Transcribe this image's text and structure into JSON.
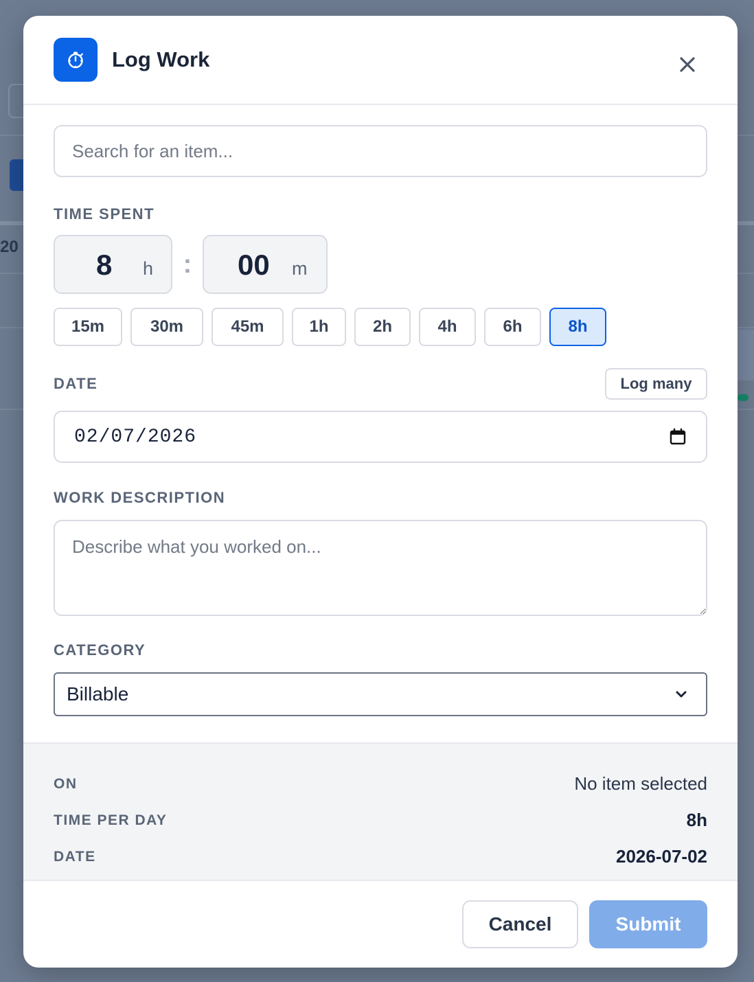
{
  "modal": {
    "title": "Log Work",
    "header_icon": "stopwatch-icon",
    "close_icon": "close-icon"
  },
  "search": {
    "placeholder": "Search for an item...",
    "value": ""
  },
  "time_spent": {
    "label": "TIME SPENT",
    "hours": "8",
    "hours_unit": "h",
    "separator": ":",
    "minutes": "00",
    "minutes_unit": "m"
  },
  "presets": [
    {
      "label": "15m",
      "active": false
    },
    {
      "label": "30m",
      "active": false
    },
    {
      "label": "45m",
      "active": false
    },
    {
      "label": "1h",
      "active": false
    },
    {
      "label": "2h",
      "active": false
    },
    {
      "label": "4h",
      "active": false
    },
    {
      "label": "6h",
      "active": false
    },
    {
      "label": "8h",
      "active": true
    }
  ],
  "date": {
    "label": "DATE",
    "log_many_label": "Log many",
    "value": "02/07/2026",
    "calendar_icon": "calendar-icon"
  },
  "description": {
    "label": "WORK DESCRIPTION",
    "placeholder": "Describe what you worked on...",
    "value": ""
  },
  "category": {
    "label": "CATEGORY",
    "selected": "Billable",
    "chevron_icon": "chevron-down-icon"
  },
  "summary": {
    "rows": [
      {
        "label": "ON",
        "value": "No item selected"
      },
      {
        "label": "TIME PER DAY",
        "value": "8h"
      },
      {
        "label": "DATE",
        "value": "2026-07-02"
      }
    ]
  },
  "footer": {
    "cancel_label": "Cancel",
    "submit_label": "Submit"
  },
  "colors": {
    "accent": "#0b63e5",
    "submit_disabled": "#80ace9",
    "preset_active_bg": "#dbe9fc",
    "overlay": "#6b7a90"
  }
}
